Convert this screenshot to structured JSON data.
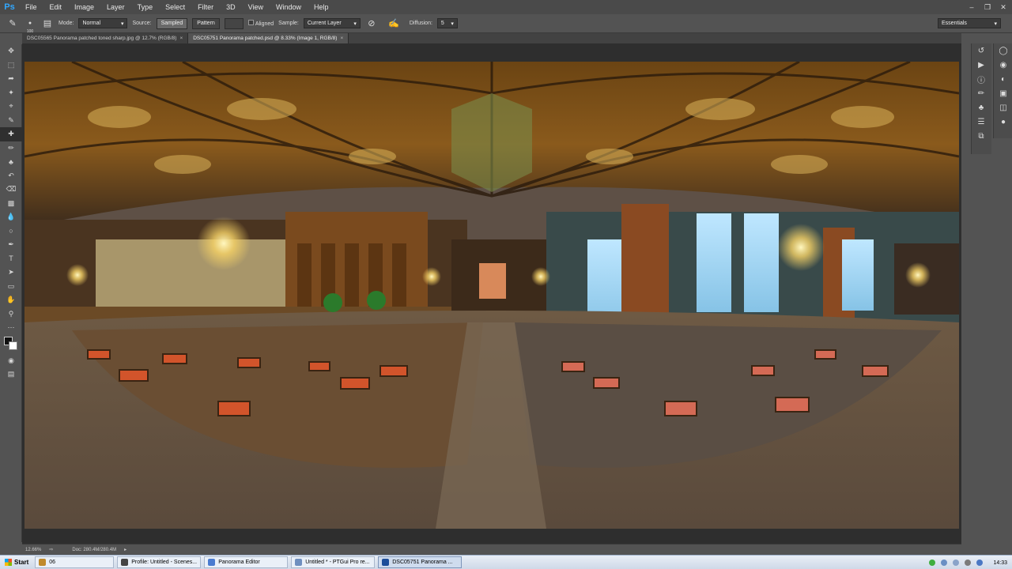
{
  "app": {
    "logo": "Ps"
  },
  "menu": [
    "File",
    "Edit",
    "Image",
    "Layer",
    "Type",
    "Select",
    "Filter",
    "3D",
    "View",
    "Window",
    "Help"
  ],
  "window_controls": [
    "minimize",
    "restore",
    "close"
  ],
  "options": {
    "mode_label": "Mode:",
    "mode_value": "Normal",
    "source_label": "Source:",
    "source_sampled": "Sampled",
    "source_pattern": "Pattern",
    "aligned_label": "Aligned",
    "sample_label": "Sample:",
    "sample_value": "Current Layer",
    "diffusion_label": "Diffusion:",
    "diffusion_value": "5",
    "brush_size": "100",
    "workspace": "Essentials"
  },
  "tabs": [
    {
      "label": "DSC05565 Panorama patched toned sharp.jpg @ 12.7% (RGB/8)",
      "active": false
    },
    {
      "label": "DSC05751 Panorama patched.psd @ 8.33% (Image 1, RGB/8)",
      "active": true
    }
  ],
  "tools": [
    "move",
    "marquee",
    "lasso",
    "quick-select",
    "crop",
    "eyedropper",
    "healing-brush",
    "brush",
    "clone-stamp",
    "history-brush",
    "eraser",
    "gradient",
    "blur",
    "dodge",
    "pen",
    "type",
    "path-select",
    "rectangle",
    "hand",
    "zoom",
    "more"
  ],
  "status": {
    "zoom": "12.66%",
    "doc": "Doc: 280.4M/280.4M"
  },
  "taskbar": {
    "start": "Start",
    "items": [
      {
        "label": "06",
        "color": "#c08a2c"
      },
      {
        "label": "Profile: Untitled - Scenes...",
        "color": "#444444"
      },
      {
        "label": "Panorama Editor",
        "color": "#4a7bd0"
      },
      {
        "label": "Untitled * - PTGui Pro re...",
        "color": "#6f8fbf"
      },
      {
        "label": "DSC05751 Panorama ...",
        "color": "#1d4e9a"
      }
    ],
    "clock": "14:33"
  },
  "colors": {
    "accent": "#31a8ff",
    "canvas_bg": "#2e2e2e",
    "ui_bg": "#535353"
  }
}
